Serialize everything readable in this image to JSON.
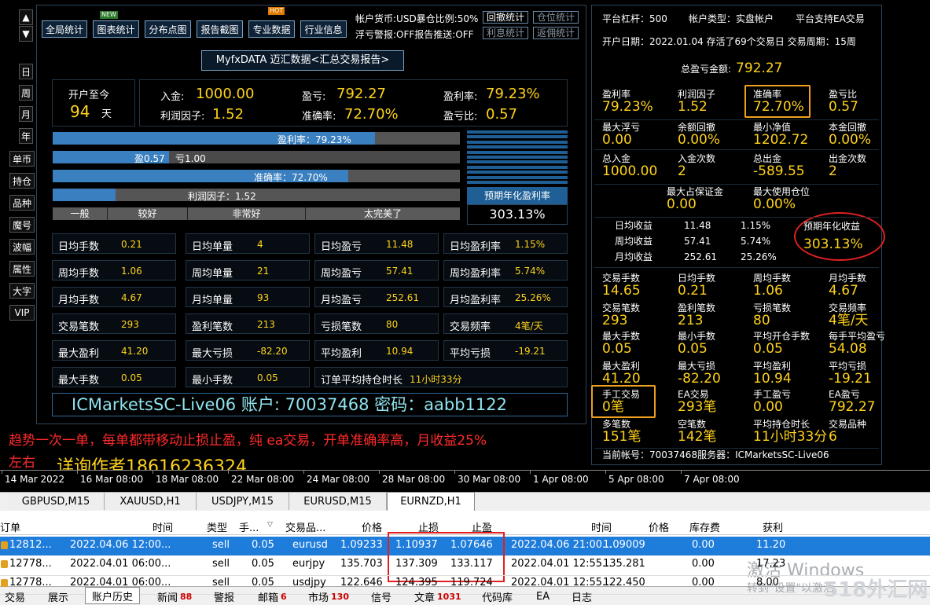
{
  "toolbar": {
    "btn1": "全局统计",
    "btn2": "图表统计",
    "btn3": "分布点图",
    "btn4": "报告截图",
    "btn5": "专业数据",
    "btn6": "行业信息",
    "new": "NEW",
    "hot": "HOT",
    "info1": "帐户货币:USD暴仓比例:50%",
    "info2": "浮亏警报:OFF报告推送:OFF",
    "r1": "回撤统计",
    "r2": "仓位统计",
    "r3": "利息统计",
    "r4": "返佣统计"
  },
  "nav": {
    "up": "▲",
    "down": "▼",
    "d": "日",
    "w": "周",
    "m": "月",
    "y": "年",
    "i1": "单币",
    "i2": "持仓",
    "i3": "品种",
    "i4": "魔号",
    "i5": "波幅",
    "i6": "属性",
    "i7": "大字",
    "i8": "VIP"
  },
  "report": {
    "title": "MyfxDATA 迈汇数据<汇总交易报告>",
    "since_label": "开户至今",
    "days": "94",
    "days_unit": "天",
    "deposit_l": "入金:",
    "deposit_v": "1000.00",
    "pf_l": "利润因子:",
    "pf_v": "1.52",
    "profit_l": "盈亏:",
    "profit_v": "792.27",
    "acc_l": "准确率:",
    "acc_v": "72.70%",
    "rate_l": "盈利率:",
    "rate_v": "79.23%",
    "ratio_l": "盈亏比:",
    "ratio_v": "0.57",
    "bar1": "盈利率：79.23%",
    "bar2a": "盈0.57",
    "bar2b": "亏1.00",
    "bar3": "准确率：72.70%",
    "bar4": "利润因子：1.52",
    "scale": [
      "一般",
      "较好",
      "非常好",
      "太完美了"
    ],
    "annual_label": "预期年化盈利率",
    "annual_value": "303.13%",
    "stats": [
      [
        "日均手数",
        "0.21",
        "日均单量",
        "4",
        "日均盈亏",
        "11.48",
        "日均盈利率",
        "1.15%"
      ],
      [
        "周均手数",
        "1.06",
        "周均单量",
        "21",
        "周均盈亏",
        "57.41",
        "周均盈利率",
        "5.74%"
      ],
      [
        "月均手数",
        "4.67",
        "月均单量",
        "93",
        "月均盈亏",
        "252.61",
        "月均盈利率",
        "25.26%"
      ],
      [
        "交易笔数",
        "293",
        "盈利笔数",
        "213",
        "亏损笔数",
        "80",
        "交易频率",
        "4笔/天"
      ],
      [
        "最大盈利",
        "41.20",
        "最大亏损",
        "-82.20",
        "平均盈利",
        "10.94",
        "平均亏损",
        "-19.21"
      ]
    ],
    "last": [
      "最大手数",
      "0.05",
      "最小手数",
      "0.05",
      "订单平均持仓时长",
      "11小时33分"
    ],
    "account_line": "ICMarketsSC-Live06 账户: 70037468  密码：aabb1122"
  },
  "right": {
    "leverage": "平台杠杆：500",
    "acct_type": "帐户类型：实盘帐户",
    "ea": "平台支持EA交易",
    "open_date": "开户日期：2022.01.04 存活了69个交易日  交易周期：15周",
    "total_l": "总盈亏金额:",
    "total_v": "792.27",
    "g1": [
      [
        "盈利率",
        "79.23%"
      ],
      [
        "利润因子",
        "1.52"
      ],
      [
        "准确率",
        "72.70%"
      ],
      [
        "盈亏比",
        "0.57"
      ]
    ],
    "g2": [
      [
        "最大浮亏",
        "0.00"
      ],
      [
        "余额回撤",
        "0.00%"
      ],
      [
        "最小净值",
        "1202.72"
      ],
      [
        "本金回撤",
        "0.00%"
      ]
    ],
    "g3": [
      [
        "总入金",
        "1000.00"
      ],
      [
        "入金次数",
        "2"
      ],
      [
        "总出金",
        "-589.55"
      ],
      [
        "出金次数",
        "2"
      ]
    ],
    "g4": [
      [
        "最大占保证金",
        "0.00"
      ],
      [
        "最大使用仓位",
        "0.00%"
      ]
    ],
    "ret": [
      [
        "日均收益",
        "11.48",
        "1.15%"
      ],
      [
        "周均收益",
        "57.41",
        "5.74%"
      ],
      [
        "月均收益",
        "252.61",
        "25.26%"
      ]
    ],
    "annual_l": "预期年化收益",
    "annual_v": "303.13%",
    "g5": [
      [
        "交易手数",
        "14.65"
      ],
      [
        "日均手数",
        "0.21"
      ],
      [
        "周均手数",
        "1.06"
      ],
      [
        "月均手数",
        "4.67"
      ]
    ],
    "g6": [
      [
        "交易笔数",
        "293"
      ],
      [
        "盈利笔数",
        "213"
      ],
      [
        "亏损笔数",
        "80"
      ],
      [
        "交易频率",
        "4笔/天"
      ]
    ],
    "g7": [
      [
        "最大手数",
        "0.05"
      ],
      [
        "最小手数",
        "0.05"
      ],
      [
        "平均开仓手数",
        "0.05"
      ],
      [
        "每手平均盈亏",
        "54.08"
      ]
    ],
    "g8": [
      [
        "最大盈利",
        "41.20"
      ],
      [
        "最大亏损",
        "-82.20"
      ],
      [
        "平均盈利",
        "10.94"
      ],
      [
        "平均亏损",
        "-19.21"
      ]
    ],
    "g9": [
      [
        "手工交易",
        "0笔"
      ],
      [
        "EA交易",
        "293笔"
      ],
      [
        "手工盈亏",
        "0.00"
      ],
      [
        "EA盈亏",
        "792.27"
      ]
    ],
    "g10": [
      [
        "多笔数",
        "151笔"
      ],
      [
        "空笔数",
        "142笔"
      ],
      [
        "平均持仓时长",
        "11小时33分"
      ],
      [
        "交易品种",
        "6"
      ]
    ],
    "current": "当前帐号：70037468服务器：ICMarketsSC-Live06"
  },
  "ad": {
    "line1": "趋势一次一单，每单都带移动止损止盈，纯 ea交易，开单准确率高，月收益25%",
    "line2": "左右",
    "contact": "详询作者18616236324"
  },
  "axis": [
    "14 Mar 2022",
    "16 Mar 08:00",
    "18 Mar 08:00",
    "22 Mar 08:00",
    "24 Mar 08:00",
    "28 Mar 08:00",
    "30 Mar 08:00",
    "1 Apr 08:00",
    "5 Apr 08:00",
    "7 Apr 08:00"
  ],
  "charttabs": [
    "GBPUSD,M15",
    "XAUUSD,H1",
    "USDJPY,M15",
    "EURUSD,M15",
    "EURNZD,H1"
  ],
  "table": {
    "headers": [
      "订单",
      "时间",
      "类型",
      "手...",
      "交易品...",
      "价格",
      "止损",
      "止盈",
      "时间",
      "价格",
      "库存费",
      "获利"
    ],
    "rows": [
      [
        "12812...",
        "2022.04.06 12:00...",
        "sell",
        "0.05",
        "eurusd",
        "1.09233",
        "1.10937",
        "1.07646",
        "2022.04.06 21:00...",
        "1.09009",
        "0.00",
        "11.20"
      ],
      [
        "12778...",
        "2022.04.01 06:00...",
        "sell",
        "0.05",
        "eurjpy",
        "135.703",
        "137.309",
        "133.117",
        "2022.04.01 12:55...",
        "135.281",
        "0.00",
        "17.23"
      ],
      [
        "12778...",
        "2022.04.01 06:00...",
        "sell",
        "0.05",
        "usdjpy",
        "122.646",
        "124.395",
        "119.724",
        "2022.04.01 12:55...",
        "122.450",
        "0.00",
        "8.00"
      ]
    ]
  },
  "bottomtabs": [
    [
      "交易",
      ""
    ],
    [
      "展示",
      ""
    ],
    [
      "账户历史",
      ""
    ],
    [
      "新闻",
      "88"
    ],
    [
      "警报",
      ""
    ],
    [
      "邮箱",
      "6"
    ],
    [
      "市场",
      "130"
    ],
    [
      "信号",
      ""
    ],
    [
      "文章",
      "1031"
    ],
    [
      "代码库",
      ""
    ],
    [
      "EA",
      ""
    ],
    [
      "日志",
      ""
    ]
  ],
  "watermark": {
    "win1": "激活 Windows",
    "win2": "转到\"设置\"以激活",
    "site": "518外汇网"
  }
}
